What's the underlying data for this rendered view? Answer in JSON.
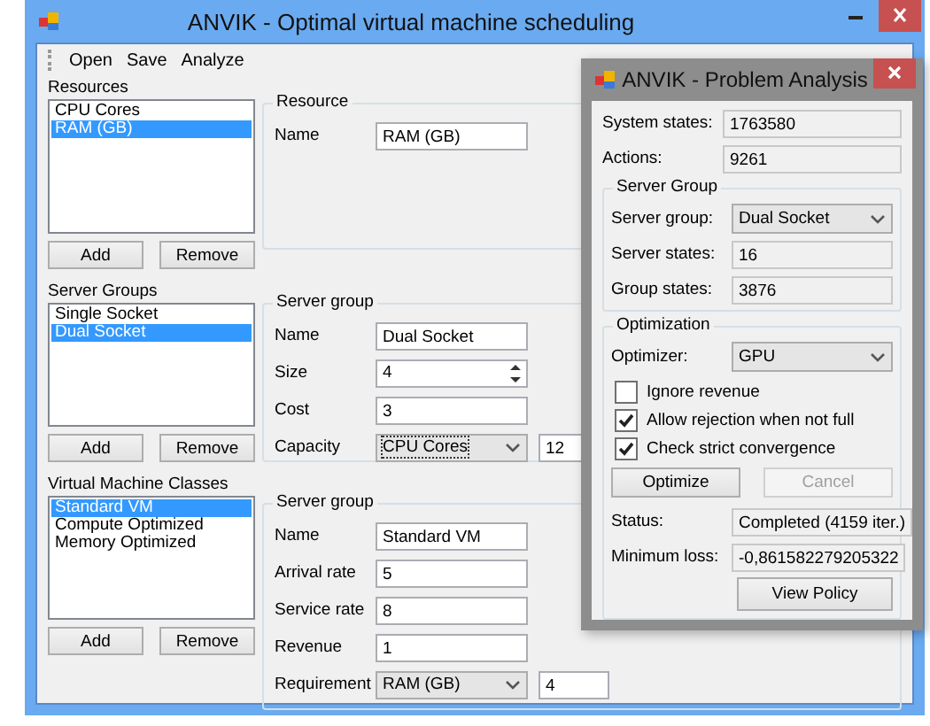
{
  "main_window": {
    "title": "ANVIK - Optimal virtual machine scheduling",
    "menu": [
      "Open",
      "Save",
      "Analyze"
    ],
    "sections": [
      {
        "list_label": "Resources",
        "items": [
          {
            "label": "CPU Cores",
            "selected": false
          },
          {
            "label": "RAM (GB)",
            "selected": true
          }
        ],
        "buttons": [
          "Add",
          "Remove"
        ],
        "group": {
          "title": "Resource",
          "fields": [
            {
              "kind": "text",
              "label": "Name",
              "value": "RAM (GB)"
            }
          ]
        }
      },
      {
        "list_label": "Server Groups",
        "items": [
          {
            "label": "Single Socket",
            "selected": false
          },
          {
            "label": "Dual Socket",
            "selected": true
          }
        ],
        "buttons": [
          "Add",
          "Remove"
        ],
        "group": {
          "title": "Server group",
          "fields": [
            {
              "kind": "text",
              "label": "Name",
              "value": "Dual Socket"
            },
            {
              "kind": "spin",
              "label": "Size",
              "value": "4"
            },
            {
              "kind": "text",
              "label": "Cost",
              "value": "3"
            },
            {
              "kind": "combo",
              "label": "Capacity",
              "value": "CPU Cores",
              "amount": "12",
              "focused": true
            }
          ]
        }
      },
      {
        "list_label": "Virtual Machine Classes",
        "items": [
          {
            "label": "Standard VM",
            "selected": true
          },
          {
            "label": "Compute Optimized",
            "selected": false
          },
          {
            "label": "Memory Optimized",
            "selected": false
          }
        ],
        "buttons": [
          "Add",
          "Remove"
        ],
        "group": {
          "title": "Server group",
          "fields": [
            {
              "kind": "text",
              "label": "Name",
              "value": "Standard VM"
            },
            {
              "kind": "text",
              "label": "Arrival rate",
              "value": "5"
            },
            {
              "kind": "text",
              "label": "Service rate",
              "value": "8"
            },
            {
              "kind": "text",
              "label": "Revenue",
              "value": "1"
            },
            {
              "kind": "combo",
              "label": "Requirement",
              "value": "RAM (GB)",
              "amount": "4",
              "focused": false
            }
          ]
        }
      }
    ]
  },
  "dialog": {
    "title": "ANVIK - Problem Analysis",
    "stats": [
      {
        "label": "System states:",
        "value": "1763580"
      },
      {
        "label": "Actions:",
        "value": "9261"
      }
    ],
    "server_group": {
      "title": "Server Group",
      "rows": [
        {
          "kind": "combo",
          "label": "Server group:",
          "value": "Dual Socket"
        },
        {
          "kind": "readonly",
          "label": "Server states:",
          "value": "16"
        },
        {
          "kind": "readonly",
          "label": "Group states:",
          "value": "3876"
        }
      ]
    },
    "optimization": {
      "title": "Optimization",
      "optimizer": {
        "label": "Optimizer:",
        "value": "GPU"
      },
      "options": [
        {
          "label": "Ignore revenue",
          "checked": false
        },
        {
          "label": "Allow rejection when not full",
          "checked": true
        },
        {
          "label": "Check strict convergence",
          "checked": true
        }
      ],
      "buttons": [
        {
          "label": "Optimize",
          "disabled": false
        },
        {
          "label": "Cancel",
          "disabled": true
        }
      ],
      "results": [
        {
          "label": "Status:",
          "value": "Completed (4159 iter.)"
        },
        {
          "label": "Minimum loss:",
          "value": "-0,861582279205322"
        }
      ],
      "view_button": "View Policy"
    }
  }
}
